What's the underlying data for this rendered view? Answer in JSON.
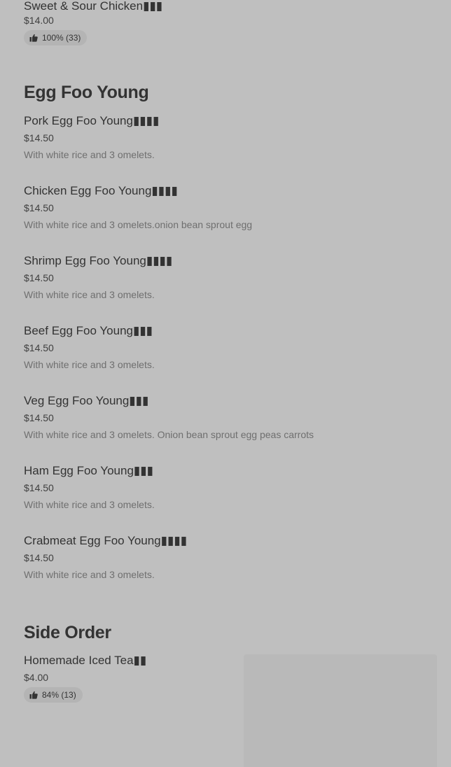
{
  "top_item": {
    "name": "Sweet & Sour Chicken▮▮▮",
    "price": "$14.00",
    "rating": "100% (33)"
  },
  "sections": {
    "egg_foo_young": {
      "title": "Egg Foo Young",
      "items": [
        {
          "name": "Pork Egg Foo Young▮▮▮▮",
          "price": "$14.50",
          "desc": "With white rice and 3 omelets."
        },
        {
          "name": "Chicken Egg Foo Young▮▮▮▮",
          "price": "$14.50",
          "desc": "With white rice and 3 omelets.onion bean sprout egg"
        },
        {
          "name": "Shrimp Egg Foo Young▮▮▮▮",
          "price": "$14.50",
          "desc": "With white rice and 3 omelets."
        },
        {
          "name": "Beef Egg Foo Young▮▮▮",
          "price": "$14.50",
          "desc": "With white rice and 3 omelets."
        },
        {
          "name": "Veg Egg Foo Young▮▮▮",
          "price": "$14.50",
          "desc": "With white rice and 3 omelets. Onion bean sprout egg peas carrots"
        },
        {
          "name": "Ham Egg Foo Young▮▮▮",
          "price": "$14.50",
          "desc": "With white rice and 3 omelets."
        },
        {
          "name": "Crabmeat Egg Foo Young▮▮▮▮",
          "price": "$14.50",
          "desc": "With white rice and 3 omelets."
        }
      ]
    },
    "side_order": {
      "title": "Side Order",
      "items": [
        {
          "name": "Homemade Iced Tea▮▮",
          "price": "$4.00",
          "rating": "84% (13)"
        }
      ]
    }
  },
  "icons": {
    "rating": "thumbs-up-icon"
  }
}
